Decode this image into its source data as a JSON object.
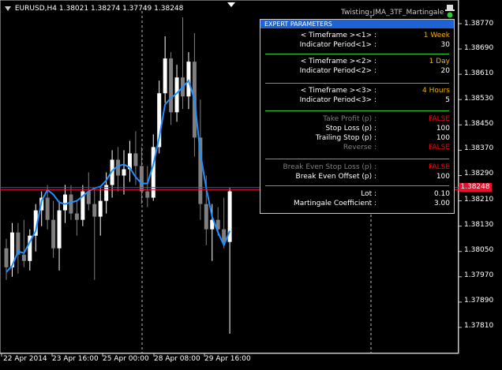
{
  "header": {
    "symbol": "EURUSD,H4",
    "ohlc": [
      "1.38021",
      "1.38274",
      "1.37749",
      "1.38248"
    ],
    "expert_name": "Twisting_JMA_3TF_Martingale"
  },
  "colors": {
    "background": "#000000",
    "bull_candle": "#ffffff",
    "bear_candle": "#7f7f7f",
    "indicator": "#1e90ff",
    "bid_line": "#e8102a",
    "ask_line": "#3b57c4",
    "panel_title": "#1e63d6",
    "separator": "#2ecc2e",
    "value_gold": "#f0b000",
    "value_false": "#ff0000"
  },
  "price_axis": {
    "labels": [
      "1.38770",
      "1.38690",
      "1.38610",
      "1.38530",
      "1.38450",
      "1.38370",
      "1.38290",
      "1.38210",
      "1.38130",
      "1.38050",
      "1.37970",
      "1.37890",
      "1.37810"
    ],
    "current_price": "1.38248"
  },
  "time_axis": {
    "labels": [
      "22 Apr 2014",
      "23 Apr 16:00",
      "25 Apr 00:00",
      "28 Apr 08:00",
      "29 Apr 16:00"
    ]
  },
  "panel": {
    "title": "EXPERT   PARAMETERS",
    "rows": [
      {
        "label": "< Timeframe ><1> :",
        "value": "1 Week",
        "style": "gold"
      },
      {
        "label": "Indicator Period<1> :",
        "value": "30",
        "style": "white"
      },
      {
        "label": "< Timeframe ><2> :",
        "value": "1 Day",
        "style": "gold"
      },
      {
        "label": "Indicator Period<2> :",
        "value": "20",
        "style": "white"
      },
      {
        "label": "< Timeframe ><3> :",
        "value": "4 Hours",
        "style": "gold"
      },
      {
        "label": "Indicator Period<3> :",
        "value": "5",
        "style": "white"
      },
      {
        "label": "Take Profit (p) :",
        "value": "FALSE",
        "style": "red",
        "dim": true
      },
      {
        "label": "Stop Loss (p) :",
        "value": "100",
        "style": "white"
      },
      {
        "label": "Trailing Stop (p) :",
        "value": "100",
        "style": "white"
      },
      {
        "label": "Reverse :",
        "value": "FALSE",
        "style": "red",
        "dim": true
      },
      {
        "label": "Break Even Stop Loss (p) :",
        "value": "FALSE",
        "style": "red",
        "dim": true
      },
      {
        "label": "Break Even Offset (p) :",
        "value": "100",
        "style": "white"
      },
      {
        "label": "Lot :",
        "value": "0.10",
        "style": "white"
      },
      {
        "label": "Martingale Coefficient :",
        "value": "3.00",
        "style": "white"
      }
    ]
  },
  "chart_data": {
    "type": "candlestick",
    "y_range": [
      1.3774,
      1.38805
    ],
    "bid_price": 1.38248,
    "ask_price": 1.38252,
    "candles": [
      {
        "o": 1.3806,
        "h": 1.3809,
        "l": 1.3796,
        "c": 1.38
      },
      {
        "o": 1.38,
        "h": 1.3814,
        "l": 1.3797,
        "c": 1.3811
      },
      {
        "o": 1.3811,
        "h": 1.3814,
        "l": 1.3798,
        "c": 1.3804
      },
      {
        "o": 1.3804,
        "h": 1.3815,
        "l": 1.38,
        "c": 1.3802
      },
      {
        "o": 1.3802,
        "h": 1.3812,
        "l": 1.3799,
        "c": 1.381
      },
      {
        "o": 1.381,
        "h": 1.382,
        "l": 1.3805,
        "c": 1.3818
      },
      {
        "o": 1.3818,
        "h": 1.3824,
        "l": 1.3813,
        "c": 1.3822
      },
      {
        "o": 1.3822,
        "h": 1.3826,
        "l": 1.3812,
        "c": 1.3815
      },
      {
        "o": 1.3815,
        "h": 1.3821,
        "l": 1.3803,
        "c": 1.3806
      },
      {
        "o": 1.3806,
        "h": 1.3821,
        "l": 1.3799,
        "c": 1.3818
      },
      {
        "o": 1.3818,
        "h": 1.3826,
        "l": 1.3814,
        "c": 1.3823
      },
      {
        "o": 1.3823,
        "h": 1.3826,
        "l": 1.3815,
        "c": 1.3817
      },
      {
        "o": 1.3817,
        "h": 1.3821,
        "l": 1.381,
        "c": 1.3815
      },
      {
        "o": 1.3815,
        "h": 1.3826,
        "l": 1.3813,
        "c": 1.3824
      },
      {
        "o": 1.3824,
        "h": 1.383,
        "l": 1.3818,
        "c": 1.382
      },
      {
        "o": 1.382,
        "h": 1.3825,
        "l": 1.3796,
        "c": 1.3816
      },
      {
        "o": 1.3816,
        "h": 1.3825,
        "l": 1.381,
        "c": 1.3821
      },
      {
        "o": 1.3821,
        "h": 1.383,
        "l": 1.3817,
        "c": 1.3826
      },
      {
        "o": 1.3826,
        "h": 1.3837,
        "l": 1.3822,
        "c": 1.3834
      },
      {
        "o": 1.3834,
        "h": 1.3838,
        "l": 1.3824,
        "c": 1.3829
      },
      {
        "o": 1.3829,
        "h": 1.3837,
        "l": 1.3823,
        "c": 1.3831
      },
      {
        "o": 1.3831,
        "h": 1.384,
        "l": 1.3827,
        "c": 1.3836
      },
      {
        "o": 1.3836,
        "h": 1.3843,
        "l": 1.3826,
        "c": 1.3832
      },
      {
        "o": 1.3832,
        "h": 1.3838,
        "l": 1.382,
        "c": 1.3824
      },
      {
        "o": 1.3824,
        "h": 1.3832,
        "l": 1.3819,
        "c": 1.3822
      },
      {
        "o": 1.3822,
        "h": 1.3842,
        "l": 1.3821,
        "c": 1.3838
      },
      {
        "o": 1.3838,
        "h": 1.3859,
        "l": 1.3836,
        "c": 1.3855
      },
      {
        "o": 1.3855,
        "h": 1.3873,
        "l": 1.3852,
        "c": 1.3866
      },
      {
        "o": 1.3866,
        "h": 1.3868,
        "l": 1.3845,
        "c": 1.3849
      },
      {
        "o": 1.3849,
        "h": 1.3864,
        "l": 1.3846,
        "c": 1.386
      },
      {
        "o": 1.386,
        "h": 1.3879,
        "l": 1.385,
        "c": 1.3854
      },
      {
        "o": 1.3854,
        "h": 1.3868,
        "l": 1.385,
        "c": 1.3865
      },
      {
        "o": 1.3865,
        "h": 1.3874,
        "l": 1.3835,
        "c": 1.3841
      },
      {
        "o": 1.3841,
        "h": 1.3853,
        "l": 1.3815,
        "c": 1.382
      },
      {
        "o": 1.382,
        "h": 1.3829,
        "l": 1.3807,
        "c": 1.3812
      },
      {
        "o": 1.3812,
        "h": 1.382,
        "l": 1.3802,
        "c": 1.3815
      },
      {
        "o": 1.3815,
        "h": 1.3819,
        "l": 1.381,
        "c": 1.3812
      },
      {
        "o": 1.3812,
        "h": 1.3822,
        "l": 1.3806,
        "c": 1.3808
      },
      {
        "o": 1.3808,
        "h": 1.3825,
        "l": 1.3779,
        "c": 1.3824
      }
    ],
    "indicator": [
      1.37985,
      1.38005,
      1.3805,
      1.38045,
      1.3808,
      1.38115,
      1.3821,
      1.38245,
      1.3823,
      1.38205,
      1.382,
      1.38205,
      1.3821,
      1.38225,
      1.3824,
      1.3825,
      1.38255,
      1.38275,
      1.38305,
      1.3832,
      1.38325,
      1.38315,
      1.38285,
      1.38265,
      1.38265,
      1.38325,
      1.3841,
      1.38515,
      1.38535,
      1.3855,
      1.3857,
      1.3859,
      1.3853,
      1.3836,
      1.3825,
      1.3816,
      1.3811,
      1.3807,
      1.38115
    ]
  }
}
